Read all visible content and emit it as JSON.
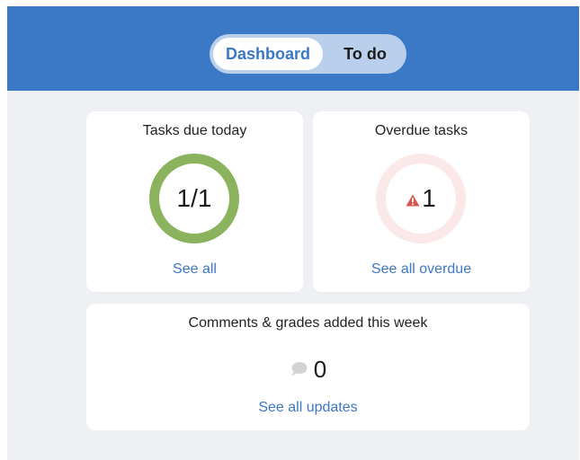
{
  "tabs": {
    "dashboard": "Dashboard",
    "todo": "To do"
  },
  "tasks_due": {
    "title": "Tasks due today",
    "value": "1/1",
    "link": "See all"
  },
  "overdue": {
    "title": "Overdue tasks",
    "value": "1",
    "link": "See all overdue"
  },
  "comments": {
    "title": "Comments & grades added this week",
    "value": "0",
    "link": "See all updates"
  },
  "icons": {
    "warning": "warning-triangle-icon",
    "comment": "comment-bubble-icon"
  },
  "colors": {
    "header": "#3b78c5",
    "accent": "#3b78c5",
    "ring_done": "#8bb25c",
    "ring_overdue": "#fbe8e8",
    "warning": "#d9534f"
  }
}
